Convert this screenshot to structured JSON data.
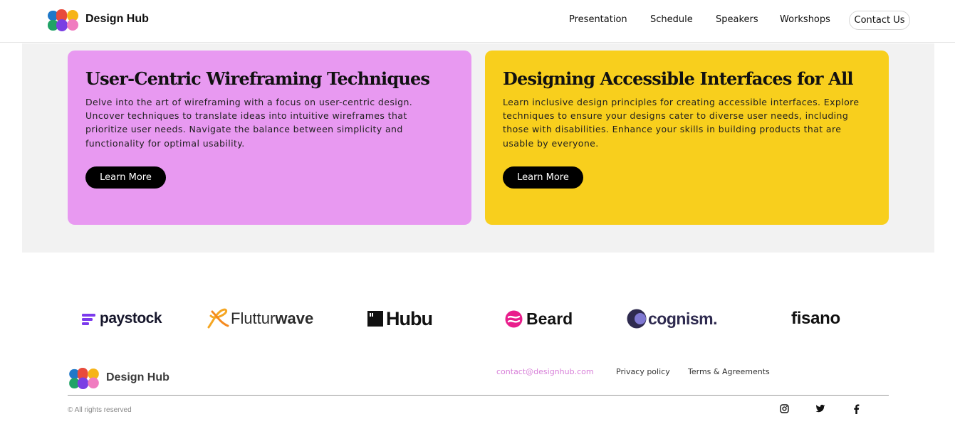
{
  "header": {
    "brand": "Design Hub",
    "nav": {
      "presentation": "Presentation",
      "schedule": "Schedule",
      "speakers": "Speakers",
      "workshops": "Workshops",
      "contact": "Contact Us"
    }
  },
  "cards": [
    {
      "title": "User-Centric Wireframing Techniques",
      "body": "Delve into the art of wireframing with a focus on user-centric design. Uncover techniques to translate ideas into intuitive wireframes that prioritize user needs. Navigate the balance between simplicity and functionality for optimal usability.",
      "button": "Learn More",
      "color": "#e899f1"
    },
    {
      "title": "Designing Accessible Interfaces for All",
      "body": "Learn inclusive design principles for creating accessible interfaces. Explore techniques to ensure your designs cater to diverse user needs, including those with disabilities. Enhance your skills in building products that are usable by everyone.",
      "button": "Learn More",
      "color": "#f8cf1d"
    }
  ],
  "partners": {
    "paystock": "paystock",
    "flutterwave_a": "Fluttur",
    "flutterwave_b": "wave",
    "hubu": "Hubu",
    "beard": "Beard",
    "cognism": "cognism.",
    "fisano": "fisano"
  },
  "footer": {
    "brand": "Design Hub",
    "email": "contact@designhub.com",
    "privacy": "Privacy policy",
    "terms": "Terms & Agreements",
    "copyright": "© All rights reserved",
    "social_icons": [
      "instagram-icon",
      "twitter-icon",
      "facebook-icon"
    ]
  },
  "colors": {
    "pink_card": "#e899f1",
    "yellow_card": "#f8cf1d",
    "email_link": "#d77fd8",
    "band": "#f2f2f2"
  }
}
